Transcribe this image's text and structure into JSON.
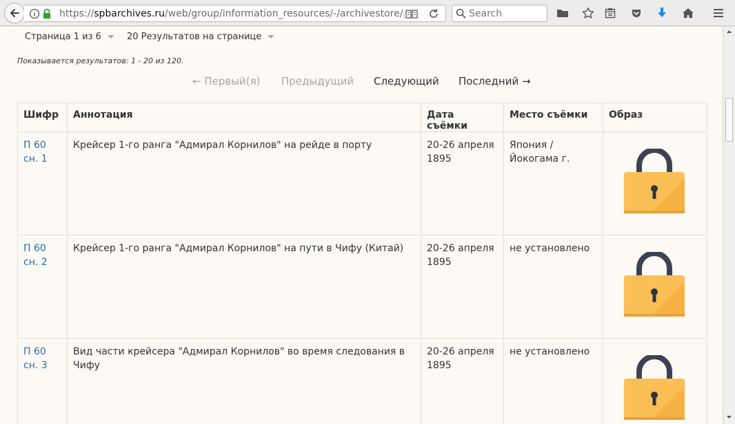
{
  "browser": {
    "url_prefix": "https://",
    "url_domain": "spbarchives.ru",
    "url_path": "/web/group/information_resources/-/archivestore/phc",
    "search_placeholder": "Search"
  },
  "pager": {
    "page_label": "Страница 1 из 6",
    "per_page_label": "20 Результатов на странице",
    "results_info": "Показывается результатов: 1 - 20 из 120.",
    "first": "← Первый(я)",
    "prev": "Предыдущий",
    "next": "Следующий",
    "last": "Последний →"
  },
  "table": {
    "headers": [
      "Шифр",
      "Аннотация",
      "Дата съёмки",
      "Место съёмки",
      "Образ"
    ],
    "rows": [
      {
        "code_line1": "П 60",
        "code_line2": "сн. 1",
        "annotation": "Крейсер 1-го ранга \"Адмирал Корнилов\" на рейде в порту",
        "date": "20-26 апреля 1895",
        "place": "Япония / Йокогама г."
      },
      {
        "code_line1": "П 60",
        "code_line2": "сн. 2",
        "annotation": "Крейсер 1-го ранга \"Адмирал Корнилов\" на пути в Чифу (Китай)",
        "date": "20-26 апреля 1895",
        "place": "не установлено"
      },
      {
        "code_line1": "П 60",
        "code_line2": "сн. 3",
        "annotation": "Вид части крейсера \"Адмирал Корнилов\" во время следования в Чифу",
        "date": "20-26 апреля 1895",
        "place": "не установлено"
      }
    ]
  },
  "colors": {
    "link": "#1f6fb0",
    "lock_body": "#fbbf55",
    "lock_shackle": "#3b4252",
    "download_arrow": "#1a8be8"
  }
}
